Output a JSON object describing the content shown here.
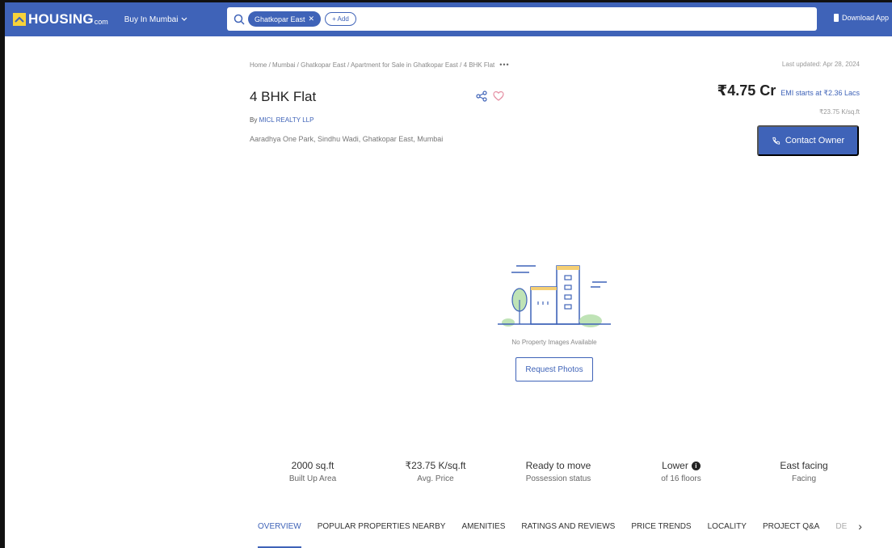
{
  "header": {
    "logo_text": "HOUSING",
    "logo_suffix": "com",
    "city_label": "Buy In Mumbai",
    "search_chip": "Ghatkopar East",
    "add_label": "+ Add",
    "download_label": "Download App"
  },
  "breadcrumb": {
    "path": "Home / Mumbai / Ghatkopar East / Apartment for Sale in Ghatkopar East / 4 BHK Flat",
    "more": "•••"
  },
  "last_updated": "Last updated: Apr 28, 2024",
  "property": {
    "title": "4 BHK Flat",
    "developer_prefix": "By",
    "developer": "MICL REALTY LLP",
    "address": "Aaradhya One Park, Sindhu Wadi, Ghatkopar East, Mumbai",
    "price": "₹4.75 Cr",
    "emi": "EMI starts at ₹2.36 Lacs",
    "rate": "₹23.75 K/sq.ft",
    "contact_label": "Contact Owner"
  },
  "placeholder": {
    "text": "No Property Images Available",
    "request_label": "Request Photos"
  },
  "stats": [
    {
      "value": "2000 sq.ft",
      "label": "Built Up Area"
    },
    {
      "value": "₹23.75 K/sq.ft",
      "label": "Avg. Price"
    },
    {
      "value": "Ready to move",
      "label": "Possession status"
    },
    {
      "value": "Lower",
      "label": "of 16 floors"
    },
    {
      "value": "East facing",
      "label": "Facing"
    }
  ],
  "tabs": [
    "OVERVIEW",
    "POPULAR PROPERTIES NEARBY",
    "AMENITIES",
    "RATINGS AND REVIEWS",
    "PRICE TRENDS",
    "LOCALITY",
    "PROJECT Q&A",
    "DE"
  ],
  "colors": {
    "brand": "#3f63b8",
    "logo_yellow": "#f7d23a"
  }
}
